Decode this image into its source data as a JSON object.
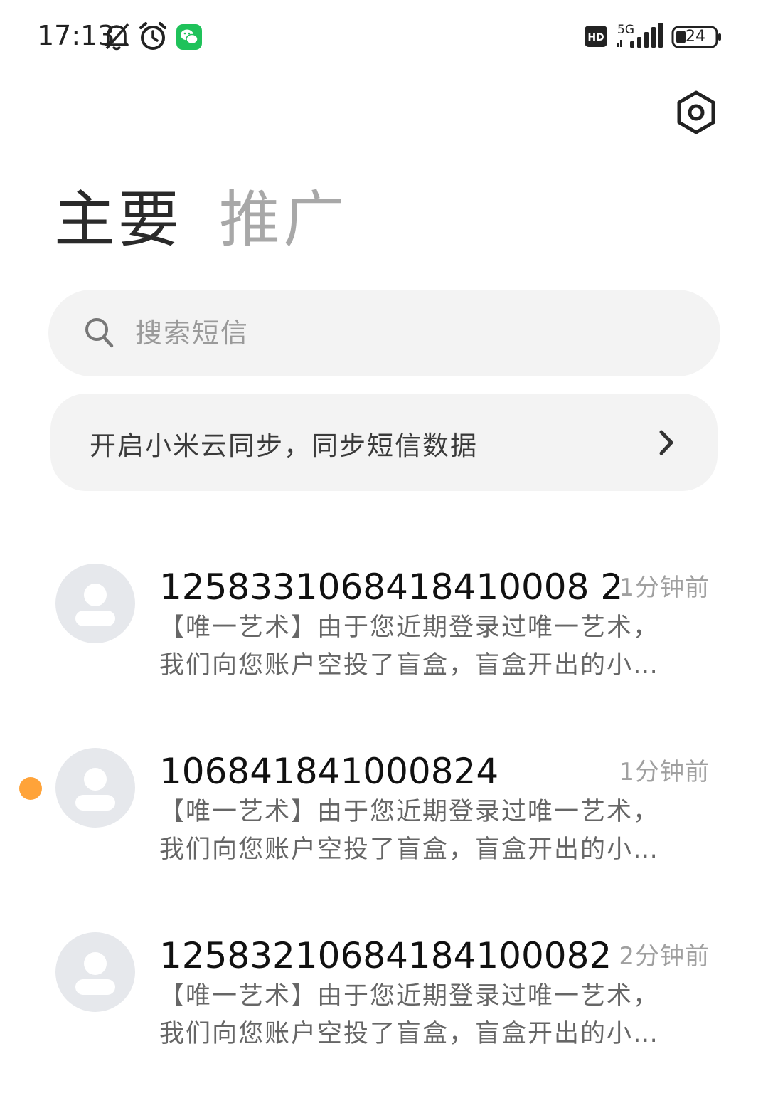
{
  "status_bar": {
    "time": "17:13",
    "icons": [
      "bell-mute-icon",
      "alarm-icon",
      "wechat-icon",
      "hd-icon",
      "signal-5g-icon",
      "battery-icon"
    ],
    "network": "5G",
    "hd_label": "HD",
    "battery_level": "24"
  },
  "header": {
    "settings_icon": "settings-hexagon-icon"
  },
  "tabs": [
    {
      "label": "主要",
      "active": true
    },
    {
      "label": "推广",
      "active": false
    }
  ],
  "search": {
    "placeholder": "搜索短信",
    "value": ""
  },
  "sync_banner": {
    "text": "开启小米云同步，同步短信数据"
  },
  "conversations": [
    {
      "sender": "1258331068418410008 2",
      "time": "1分钟前",
      "preview_line1": "【唯一艺术】由于您近期登录过唯一艺术，",
      "preview_line2": "我们向您账户空投了盲盒，盲盒开出的小…",
      "unread": false
    },
    {
      "sender": "106841841000824",
      "time": "1分钟前",
      "preview_line1": "【唯一艺术】由于您近期登录过唯一艺术，",
      "preview_line2": "我们向您账户空投了盲盒，盲盒开出的小…",
      "unread": true
    },
    {
      "sender": "12583210684184100082",
      "time": "2分钟前",
      "preview_line1": "【唯一艺术】由于您近期登录过唯一艺术，",
      "preview_line2": "我们向您账户空投了盲盒，盲盒开出的小…",
      "unread": false
    }
  ],
  "colors": {
    "unread_dot": "#ffa339",
    "wechat": "#1fc25a",
    "surface": "#f3f3f3"
  }
}
